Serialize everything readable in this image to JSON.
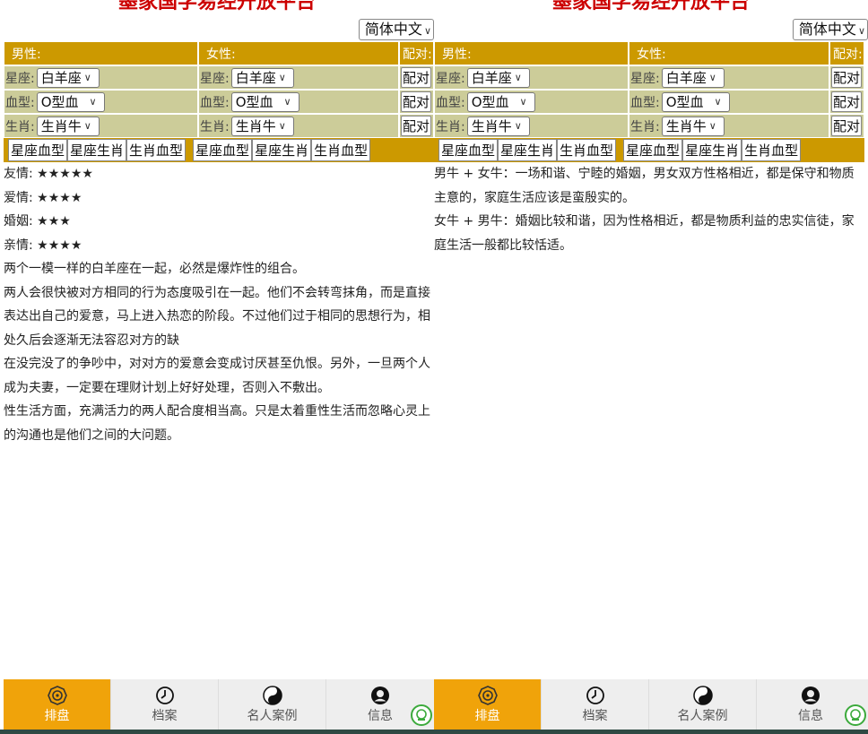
{
  "site_title": "墨家国学易经开放平台",
  "language": "简体中文",
  "headers": {
    "male": "男性:",
    "female": "女性:",
    "pair": "配对:"
  },
  "labels": {
    "zodiac": "星座:",
    "blood": "血型:",
    "animal": "生肖:"
  },
  "values": {
    "zodiac": "白羊座",
    "blood": "O型血",
    "animal": "生肖牛"
  },
  "pair_button": "配对",
  "mode_tabs": [
    "星座血型",
    "星座生肖",
    "生肖血型"
  ],
  "left": {
    "ratings": [
      {
        "label": "友情:",
        "stars": "★★★★★"
      },
      {
        "label": "爱情:",
        "stars": "★★★★"
      },
      {
        "label": "婚姻:",
        "stars": "★★★"
      },
      {
        "label": "亲情:",
        "stars": "★★★★"
      }
    ],
    "paragraphs": [
      "两个一模一样的白羊座在一起，必然是爆炸性的组合。",
      "两人会很快被对方相同的行为态度吸引在一起。他们不会转弯抹角，而是直接表达出自己的爱意，马上进入热恋的阶段。不过他们过于相同的思想行为，相处久后会逐渐无法容忍对方的缺",
      "在没完没了的争吵中，对对方的爱意会变成讨厌甚至仇恨。另外，一旦两个人成为夫妻，一定要在理财计划上好好处理，否则入不敷出。",
      "性生活方面，充满活力的两人配合度相当高。只是太着重性生活而忽略心灵上的沟通也是他们之间的大问题。"
    ]
  },
  "right": {
    "paragraphs": [
      "男牛 + 女牛：一场和谐、宁睦的婚姻，男女双方性格相近，都是保守和物质主意的，家庭生活应该是蛮殷实的。",
      "女牛 + 男牛：婚姻比较和谐，因为性格相近，都是物质利益的忠实信徒，家庭生活一般都比较恬适。"
    ]
  },
  "nav": [
    {
      "label": "排盘",
      "icon": "bagua-icon",
      "active": true
    },
    {
      "label": "档案",
      "icon": "clock-icon",
      "active": false
    },
    {
      "label": "名人案例",
      "icon": "yinyang-icon",
      "active": false
    },
    {
      "label": "信息",
      "icon": "user-icon",
      "active": false
    }
  ],
  "colors": {
    "header_gold": "#cc9900",
    "row_khaki": "#cccc99",
    "nav_active": "#f0a30a",
    "title_red": "#cc0000"
  }
}
